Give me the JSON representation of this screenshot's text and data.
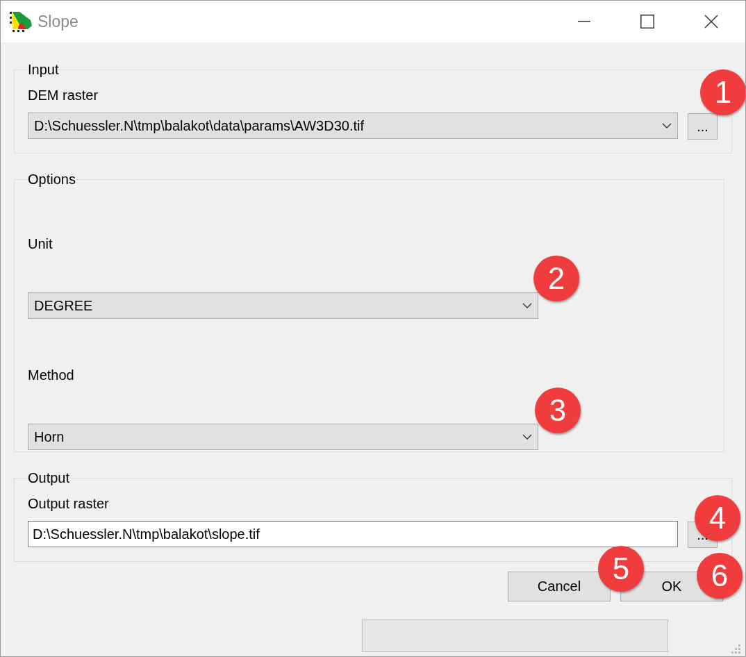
{
  "window": {
    "title": "Slope"
  },
  "input": {
    "title": "Input",
    "label": "DEM raster",
    "value": "D:\\Schuessler.N\\tmp\\balakot\\data\\params\\AW3D30.tif",
    "browse": "..."
  },
  "options": {
    "title": "Options",
    "fields": [
      {
        "label": "Unit",
        "value": "DEGREE"
      },
      {
        "label": "Method",
        "value": "Horn"
      }
    ]
  },
  "output": {
    "title": "Output",
    "label": "Output raster",
    "value": "D:\\Schuessler.N\\tmp\\balakot\\slope.tif",
    "browse": "..."
  },
  "buttons": [
    "Cancel",
    "OK"
  ],
  "progress": {
    "level": 0
  },
  "callouts": [
    "1",
    "2",
    "3",
    "4",
    "5",
    "6"
  ]
}
